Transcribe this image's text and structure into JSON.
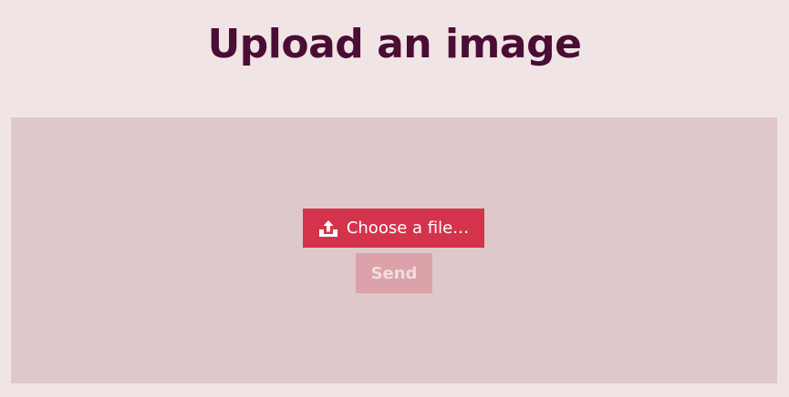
{
  "page": {
    "title": "Upload an image"
  },
  "upload": {
    "choose_label": "Choose a file…",
    "choose_icon": "upload-icon",
    "send_label": "Send",
    "send_disabled": true
  },
  "colors": {
    "background": "#f1e4e5",
    "panel": "#dfc8ca",
    "title": "#4a0d33",
    "primary": "#d3344c",
    "disabled": "#dba2a9"
  }
}
